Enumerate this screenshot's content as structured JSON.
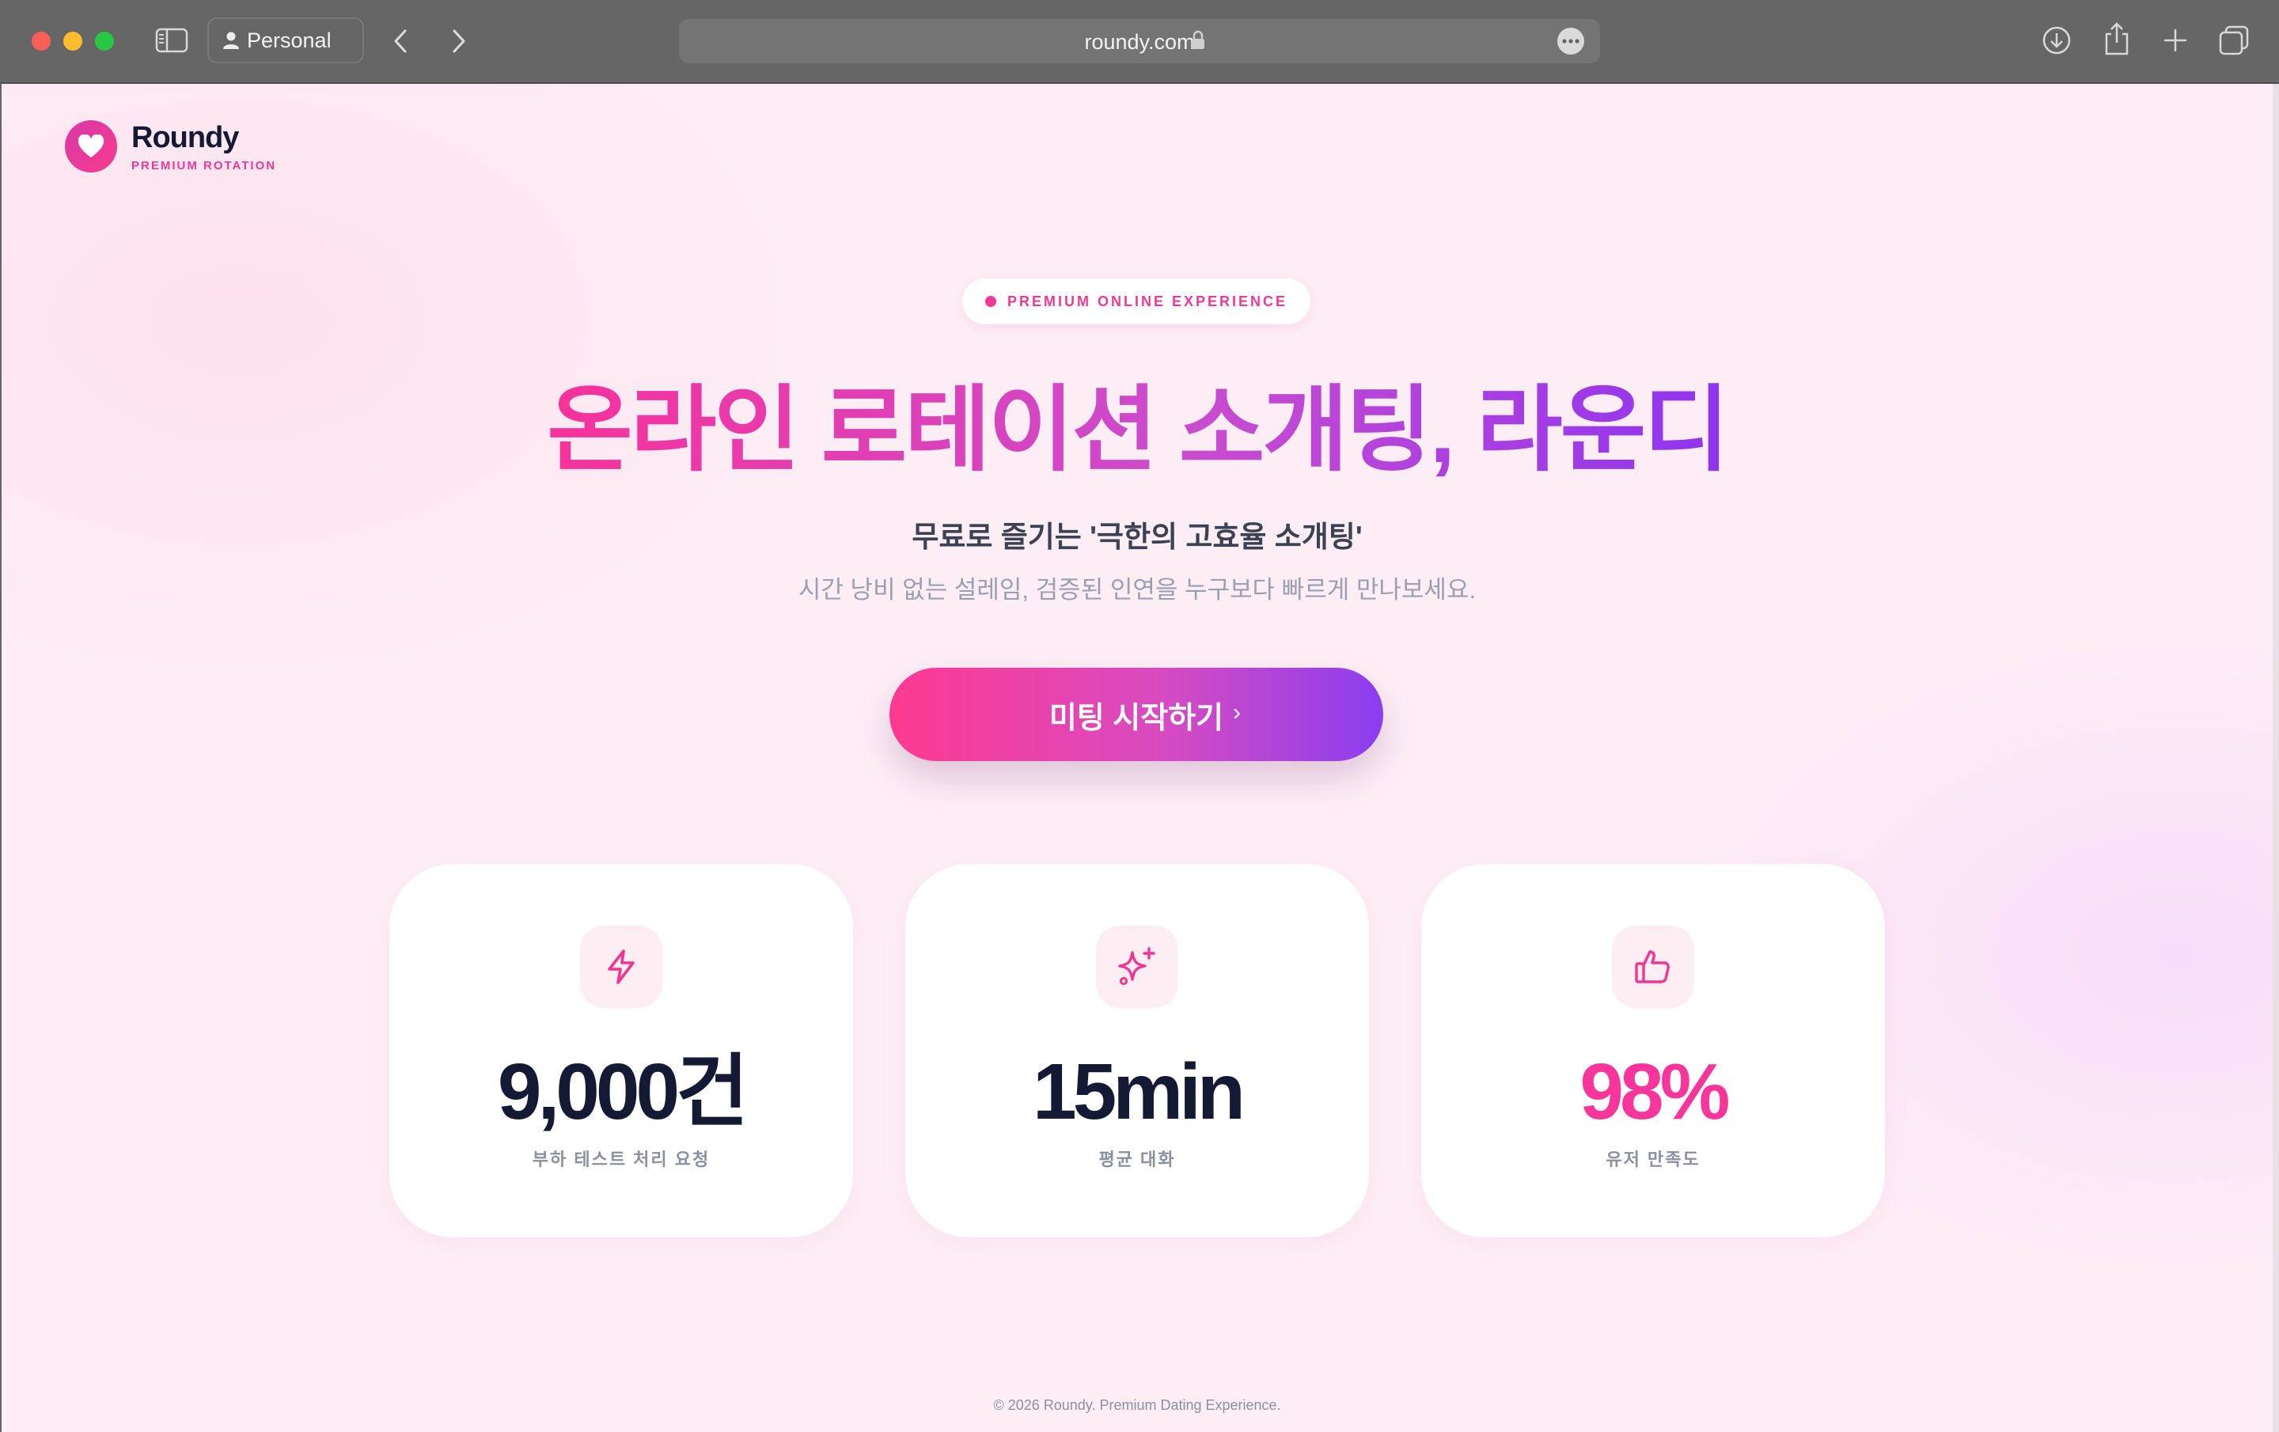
{
  "browser": {
    "profile_label": "Personal",
    "url": "roundy.com"
  },
  "brand": {
    "name": "Roundy",
    "tagline": "PREMIUM ROTATION"
  },
  "hero": {
    "badge": "PREMIUM ONLINE EXPERIENCE",
    "title": "온라인 로테이션 소개팅, 라운디",
    "subtitle": "무료로 즐기는 '극한의 고효율 소개팅'",
    "description": "시간 낭비 없는 설레임, 검증된 인연을 누구보다 빠르게 만나보세요.",
    "cta_label": "미팅 시작하기",
    "cta_arrow": "›"
  },
  "stats": [
    {
      "icon": "lightning-icon",
      "value": "9,000건",
      "label": "부하 테스트 처리 요청"
    },
    {
      "icon": "sparkles-icon",
      "value": "15min",
      "label": "평균 대화"
    },
    {
      "icon": "thumbs-up-icon",
      "value": "98%",
      "label": "유저 만족도"
    }
  ],
  "footer": {
    "copyright": "© 2026 Roundy. Premium Dating Experience."
  },
  "colors": {
    "brand_pink": "#f7359a",
    "brand_purple": "#8a3ef0",
    "heading_dark": "#141a33",
    "page_background": "#fdeef5"
  }
}
